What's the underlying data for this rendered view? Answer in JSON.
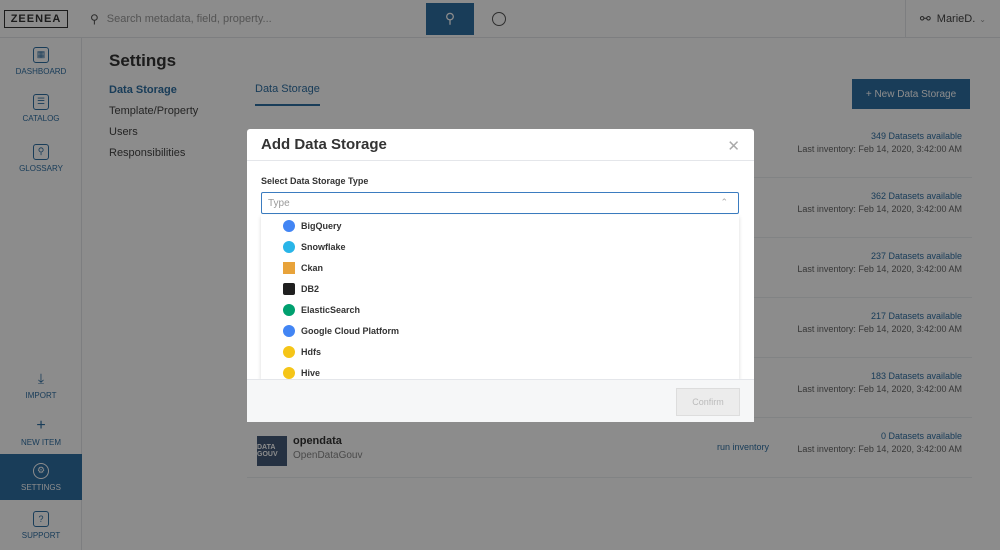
{
  "topbar": {
    "logo": "ZEENEA",
    "search_placeholder": "Search metadata, field, property...",
    "user": "MarieD."
  },
  "sidebar": {
    "items": [
      {
        "label": "DASHBOARD",
        "icon": "dashboard-icon"
      },
      {
        "label": "CATALOG",
        "icon": "catalog-icon"
      },
      {
        "label": "GLOSSARY",
        "icon": "glossary-icon"
      },
      {
        "label": "IMPORT",
        "icon": "import-icon"
      },
      {
        "label": "NEW ITEM",
        "icon": "plus-icon"
      },
      {
        "label": "SETTINGS",
        "icon": "gear-icon"
      },
      {
        "label": "SUPPORT",
        "icon": "support-icon"
      }
    ],
    "active": "SETTINGS"
  },
  "main": {
    "title": "Settings",
    "submenu": [
      "Data Storage",
      "Template/Property",
      "Users",
      "Responsibilities"
    ],
    "tab": "Data Storage",
    "new_button": "+ New Data Storage",
    "rows": [
      {
        "count": "349 Datasets available",
        "last": "Last inventory: Feb 14, 2020, 3:42:00 AM",
        "run": "ntory"
      },
      {
        "count": "362 Datasets available",
        "last": "Last inventory: Feb 14, 2020, 3:42:00 AM",
        "run": "ntory"
      },
      {
        "count": "237 Datasets available",
        "last": "Last inventory: Feb 14, 2020, 3:42:00 AM",
        "run": "ntory"
      },
      {
        "count": "217 Datasets available",
        "last": "Last inventory: Feb 14, 2020, 3:42:00 AM",
        "run": "ntory"
      },
      {
        "count": "183 Datasets available",
        "last": "Last inventory: Feb 14, 2020, 3:42:00 AM",
        "run": "ntory"
      },
      {
        "count": "0 Datasets available",
        "last": "Last inventory: Feb 14, 2020, 3:42:00 AM",
        "run": "run inventory",
        "name": "opendata",
        "type": "OpenDataGouv",
        "logo_text": "DATA GOUV"
      }
    ]
  },
  "modal": {
    "title": "Add Data Storage",
    "select_label": "Select Data Storage Type",
    "input_placeholder": "Type",
    "options": [
      {
        "label": "BigQuery",
        "color": "#4285f4"
      },
      {
        "label": "Snowflake",
        "color": "#29b5e8"
      },
      {
        "label": "Ckan",
        "color": "#e8a33a"
      },
      {
        "label": "DB2",
        "color": "#1f1f1f"
      },
      {
        "label": "ElasticSearch",
        "color": "#00a06f"
      },
      {
        "label": "Google Cloud Platform",
        "color": "#4285f4"
      },
      {
        "label": "Hdfs",
        "color": "#f5c518"
      },
      {
        "label": "Hive",
        "color": "#f5c518"
      }
    ],
    "confirm": "Confirm"
  }
}
